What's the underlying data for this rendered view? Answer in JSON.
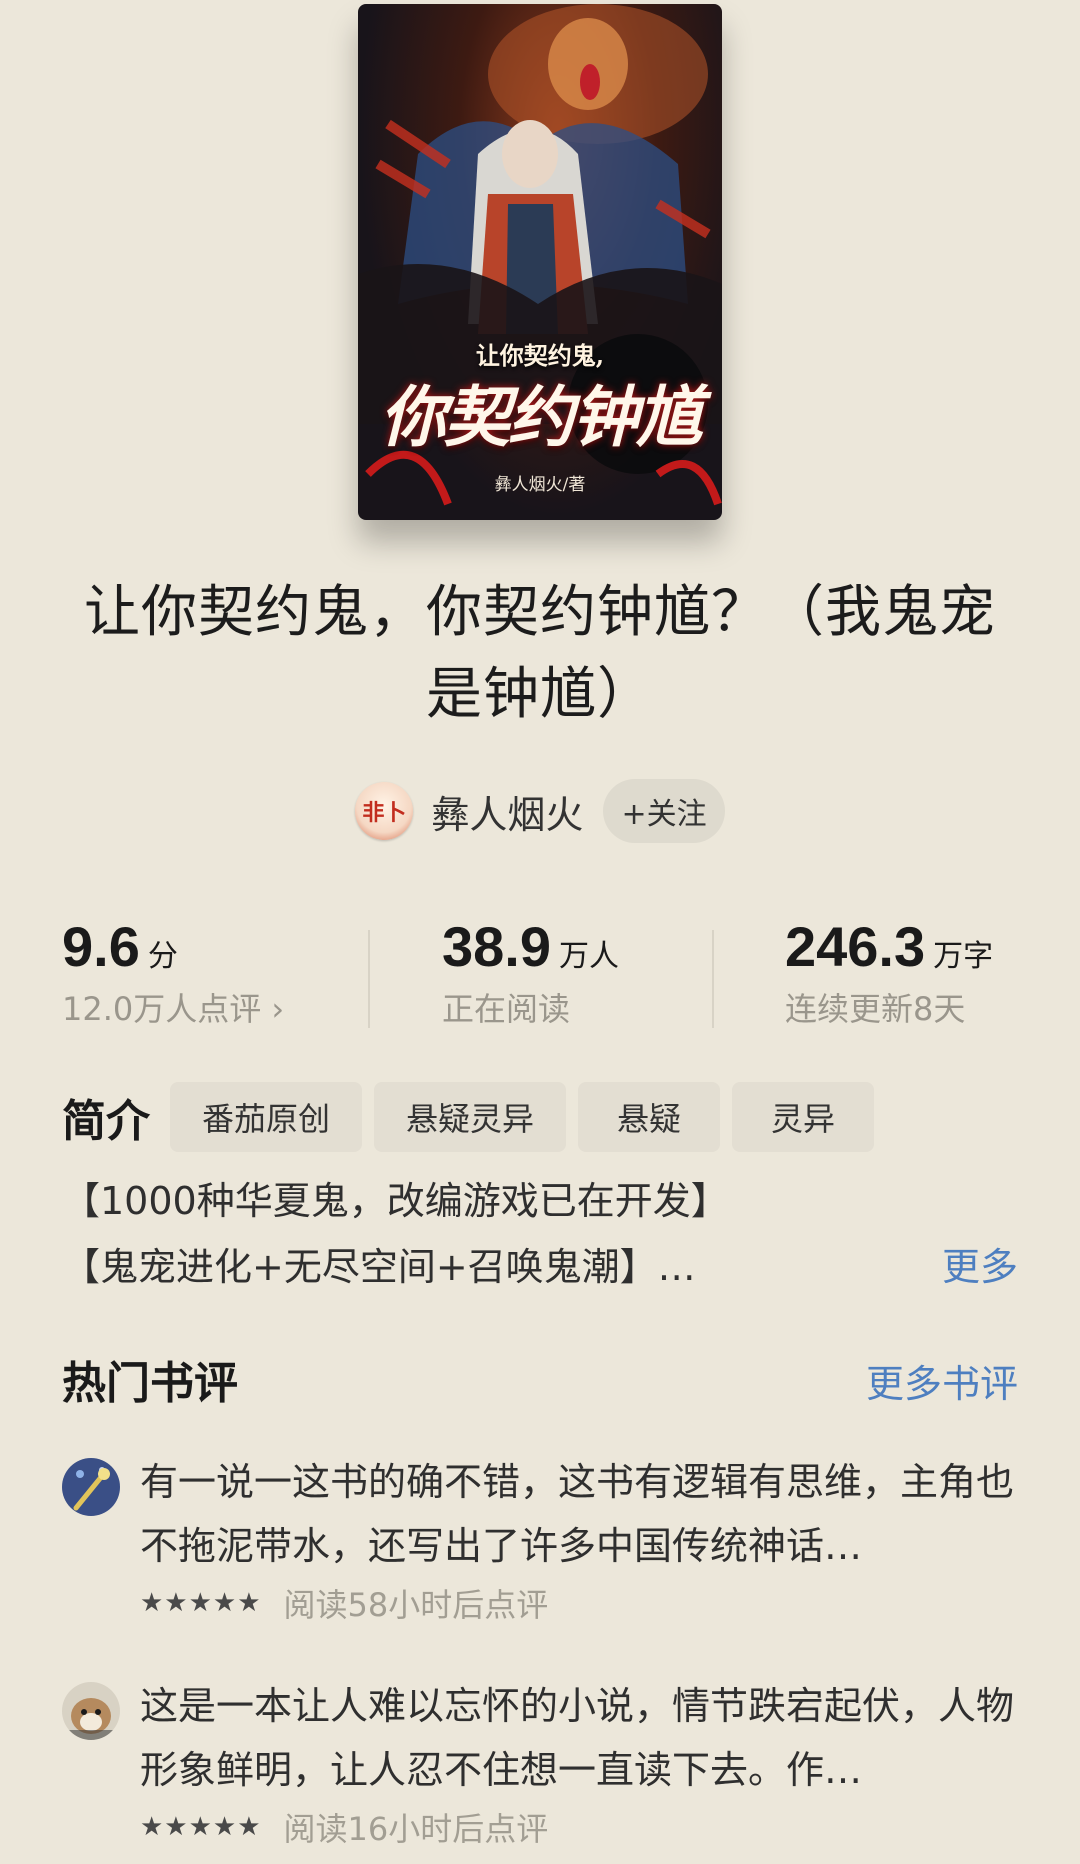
{
  "cover": {
    "title_line1": "让你契约鬼,",
    "title_line2": "你契约钟馗",
    "author_credit": "彝人烟火/著"
  },
  "book": {
    "title": "让你契约鬼，你契约钟馗？（我鬼宠是钟馗）"
  },
  "author": {
    "avatar_text": "非卜",
    "name": "彝人烟火",
    "follow_label": "+关注"
  },
  "stats": {
    "score": {
      "value": "9.6",
      "unit": "分",
      "sub": "12.0万人点评 ›"
    },
    "readers": {
      "value": "38.9",
      "unit": "万人",
      "sub": "正在阅读"
    },
    "words": {
      "value": "246.3",
      "unit": "万字",
      "sub": "连续更新8天"
    }
  },
  "intro": {
    "label": "简介",
    "tags": [
      "番茄原创",
      "悬疑灵异",
      "悬疑",
      "灵异"
    ],
    "lines": [
      "【1000种华夏鬼，改编游戏已在开发】",
      "【鬼宠进化+无尽空间+召唤鬼潮】…"
    ],
    "more_label": "更多"
  },
  "reviews": {
    "title": "热门书评",
    "more_label": "更多书评",
    "items": [
      {
        "text": "有一说一这书的确不错，这书有逻辑有思维，主角也不拖泥带水，还写出了许多中国传统神话…",
        "stars": "★★★★★",
        "rating": 5,
        "time": "阅读58小时后点评"
      },
      {
        "text": "这是一本让人难以忘怀的小说，情节跌宕起伏，人物形象鲜明，让人忍不住想一直读下去。作…",
        "stars": "★★★★★",
        "rating": 5,
        "time": "阅读16小时后点评"
      }
    ]
  }
}
